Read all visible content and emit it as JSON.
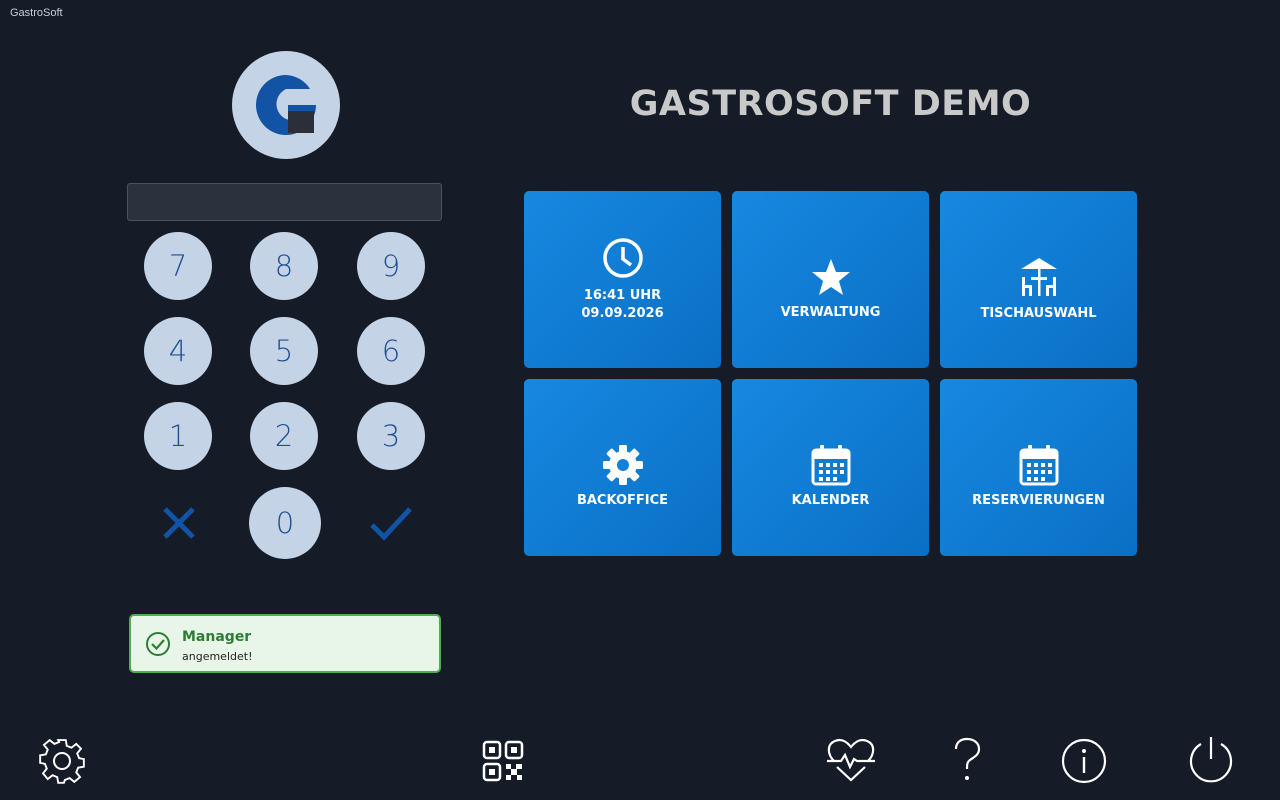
{
  "window": {
    "title": "GastroSoft"
  },
  "header": {
    "title": "GASTROSOFT DEMO"
  },
  "keypad": {
    "pin_value": "",
    "keys": [
      "7",
      "8",
      "9",
      "4",
      "5",
      "6",
      "1",
      "2",
      "3",
      "0"
    ],
    "cancel_icon": "x-icon",
    "confirm_icon": "check-icon"
  },
  "toast": {
    "title": "Manager",
    "message": "angemeldet!",
    "status_color": "#4caf50"
  },
  "tiles": {
    "clock": {
      "time": "16:41 UHR",
      "date": "09.09.2026",
      "icon": "clock-icon"
    },
    "verwaltung": {
      "label": "VERWALTUNG",
      "icon": "star-icon"
    },
    "tischauswahl": {
      "label": "TISCHAUSWAHL",
      "icon": "table-icon"
    },
    "backoffice": {
      "label": "BACKOFFICE",
      "icon": "gear-icon"
    },
    "kalender": {
      "label": "KALENDER",
      "icon": "calendar-icon"
    },
    "reservierungen": {
      "label": "RESERVIERUNGEN",
      "icon": "calendar-icon"
    }
  },
  "bottom_bar": [
    "settings-icon",
    "qr-code-icon",
    "heartbeat-icon",
    "help-icon",
    "info-icon",
    "power-icon"
  ],
  "colors": {
    "background": "#151b27",
    "tile": "#0a78d7",
    "key": "#c4d3e6",
    "key_text": "#1e4f93"
  }
}
